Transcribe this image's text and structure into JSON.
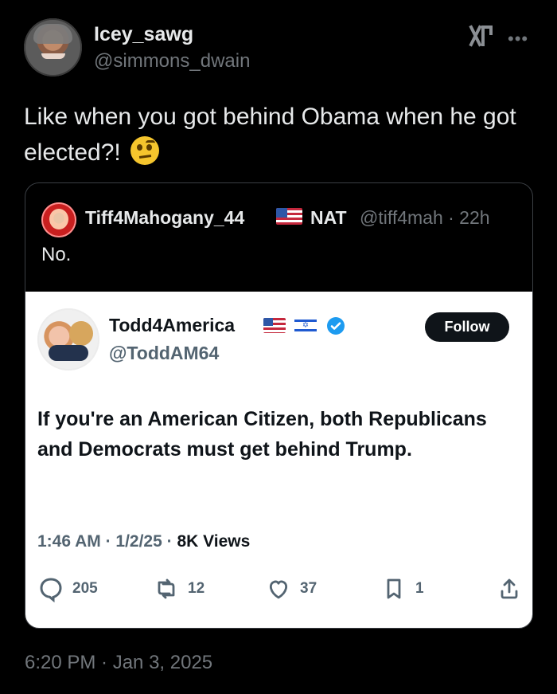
{
  "header": {
    "display_name": "Icey_sawg",
    "handle": "@simmons_dwain"
  },
  "tweet": {
    "text": "Like when you got behind Obama when he got elected?!"
  },
  "quote": {
    "name": "Tiff4Mahogany_44",
    "nat_text": "NAT",
    "handle_time": "@tiff4mah · 22h",
    "text": "No."
  },
  "embedded_post": {
    "name": "Todd4America",
    "handle": "@ToddAM64",
    "follow_label": "Follow",
    "body": "If you're an American Citizen, both Republicans and Democrats must get behind Trump.",
    "meta_time": "1:46 AM · 1/2/25 · ",
    "meta_views": "8K Views",
    "actions": {
      "replies": "205",
      "reposts": "12",
      "likes": "37",
      "bookmarks": "1"
    }
  },
  "timestamp": "6:20 PM · Jan 3, 2025",
  "colors": {
    "background": "#000000",
    "text_primary": "#e7e9ea",
    "text_secondary": "#71767b",
    "embed_background": "#ffffff",
    "embed_text": "#0f1419",
    "embed_secondary": "#536471",
    "verified_blue": "#1d9bf0"
  },
  "icons": {
    "more": "more-horizontal-icon",
    "grok": "grok-icon",
    "verified": "verified-badge-icon",
    "reply": "reply-icon",
    "repost": "repost-icon",
    "like": "heart-icon",
    "bookmark": "bookmark-icon",
    "share": "share-icon"
  }
}
